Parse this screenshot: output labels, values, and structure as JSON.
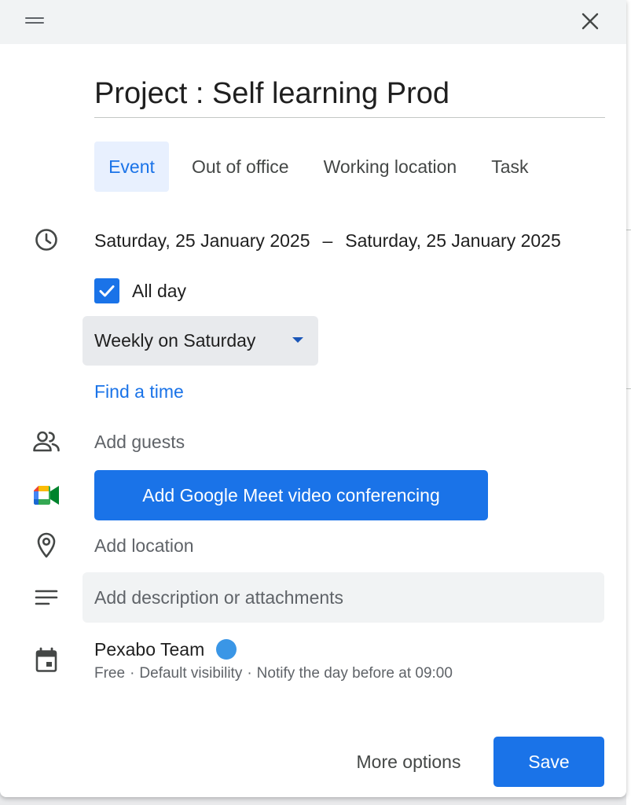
{
  "dialog": {
    "title": "Project :  Self learning Prod",
    "close_icon": "close-icon",
    "drag_icon": "drag-handle-icon"
  },
  "tabs": [
    {
      "label": "Event",
      "active": true
    },
    {
      "label": "Out of office",
      "active": false
    },
    {
      "label": "Working location",
      "active": false
    },
    {
      "label": "Task",
      "active": false
    }
  ],
  "schedule": {
    "icon": "clock-icon",
    "start_date": "Saturday, 25 January 2025",
    "separator": "–",
    "end_date": "Saturday, 25 January 2025",
    "all_day_label": "All day",
    "all_day_checked": true,
    "repeat": "Weekly on Saturday",
    "find_time": "Find a time"
  },
  "guests": {
    "icon": "people-icon",
    "placeholder": "Add guests"
  },
  "meet": {
    "icon": "google-meet-icon",
    "label": "Add Google Meet video conferencing"
  },
  "location": {
    "icon": "location-pin-icon",
    "placeholder": "Add location"
  },
  "description": {
    "icon": "notes-icon",
    "placeholder": "Add description or attachments"
  },
  "calendar": {
    "icon": "calendar-icon",
    "name": "Pexabo Team",
    "color": "#3a96e6",
    "availability": "Free",
    "visibility": "Default visibility",
    "notification": "Notify the day before at 09:00",
    "separator": "·"
  },
  "footer": {
    "more_options": "More options",
    "save": "Save"
  },
  "colors": {
    "accent": "#1a73e8",
    "active_tab_bg": "#e8f0fe",
    "header_bg": "#f1f3f4"
  }
}
